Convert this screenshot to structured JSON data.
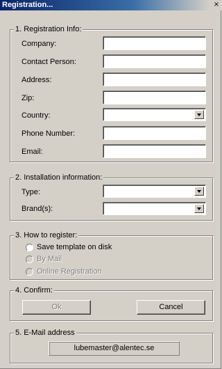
{
  "window": {
    "title": "Registration...",
    "close_glyph": "×"
  },
  "registration_info": {
    "legend": "1. Registration Info:",
    "fields": [
      {
        "label": "Company:",
        "value": ""
      },
      {
        "label": "Contact Person:",
        "value": ""
      },
      {
        "label": "Address:",
        "value": ""
      },
      {
        "label": "Zip:",
        "value": ""
      },
      {
        "label": "Country:",
        "value": ""
      },
      {
        "label": "Phone Number:",
        "value": ""
      },
      {
        "label": "Email:",
        "value": ""
      }
    ]
  },
  "installation_info": {
    "legend": "2. Installation information:",
    "fields": [
      {
        "label": "Type:",
        "value": ""
      },
      {
        "label": "Brand(s):",
        "value": ""
      }
    ]
  },
  "how_to_register": {
    "legend": "3. How to register:",
    "options": [
      {
        "label": "Save template on disk",
        "enabled": true
      },
      {
        "label": "By Mail",
        "enabled": false
      },
      {
        "label": "Online Registration",
        "enabled": false
      }
    ]
  },
  "confirm": {
    "legend": "4. Confirm:",
    "ok_label": "Ok",
    "cancel_label": "Cancel"
  },
  "email_address": {
    "legend": "5. E-Mail address",
    "value": "lubemaster@alentec.se"
  },
  "colors": {
    "face": "#d4d0c8",
    "titlebar_start": "#0a246a",
    "titlebar_end": "#3a6ea5",
    "disabled_text": "#808080"
  }
}
